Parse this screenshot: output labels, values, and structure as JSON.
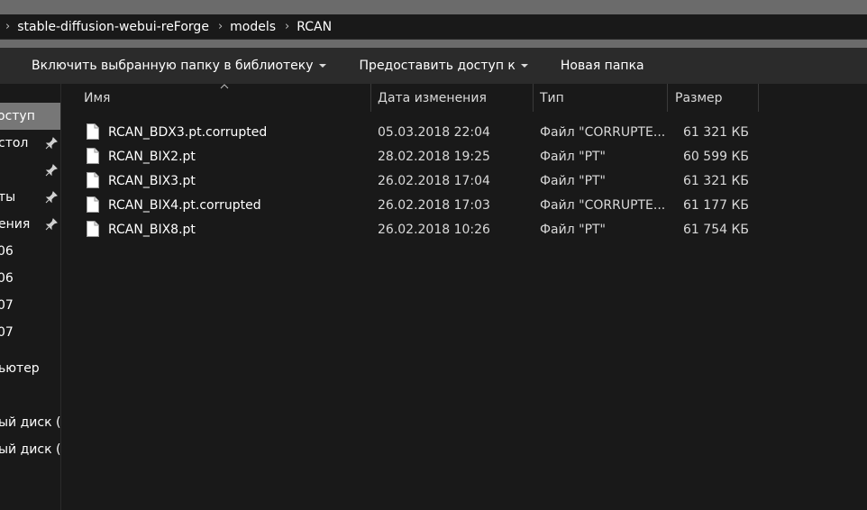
{
  "breadcrumb": [
    "stable-diffusion-webui-reForge",
    "models",
    "RCAN"
  ],
  "toolbar": {
    "include_library": "Включить выбранную папку в библиотеку",
    "share": "Предоставить доступ к",
    "new_folder": "Новая папка"
  },
  "nav": [
    {
      "label": "оступ",
      "selected": true
    },
    {
      "label": "стол",
      "pinned": true
    },
    {
      "label": "",
      "pinned": true
    },
    {
      "label": "ты",
      "pinned": true
    },
    {
      "label": "ения",
      "pinned": true
    },
    {
      "label": "06"
    },
    {
      "label": "06"
    },
    {
      "label": "07"
    },
    {
      "label": "07"
    },
    {
      "label": "ьютер"
    },
    {
      "label": "ый диск (C"
    },
    {
      "label": "ый диск (D"
    }
  ],
  "columns": {
    "name": "Имя",
    "date": "Дата изменения",
    "type": "Тип",
    "size": "Размер"
  },
  "files": [
    {
      "name": "RCAN_BDX3.pt.corrupted",
      "date": "05.03.2018 22:04",
      "type": "Файл \"CORRUPTE...",
      "size": "61 321 КБ"
    },
    {
      "name": "RCAN_BIX2.pt",
      "date": "28.02.2018 19:25",
      "type": "Файл \"PT\"",
      "size": "60 599 КБ"
    },
    {
      "name": "RCAN_BIX3.pt",
      "date": "26.02.2018 17:04",
      "type": "Файл \"PT\"",
      "size": "61 321 КБ"
    },
    {
      "name": "RCAN_BIX4.pt.corrupted",
      "date": "26.02.2018 17:03",
      "type": "Файл \"CORRUPTE...",
      "size": "61 177 КБ"
    },
    {
      "name": "RCAN_BIX8.pt",
      "date": "26.02.2018 10:26",
      "type": "Файл \"PT\"",
      "size": "61 754 КБ"
    }
  ],
  "colors": {
    "background": "#191919",
    "toolbar": "#2b2b2b",
    "selected": "#777777",
    "strip": "#6b6b6b"
  }
}
